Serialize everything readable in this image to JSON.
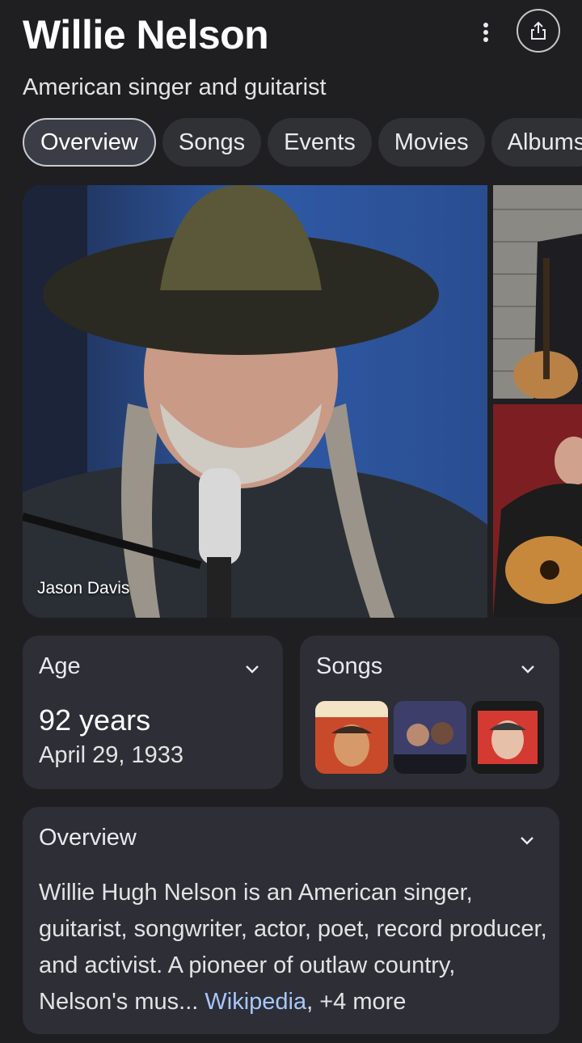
{
  "header": {
    "title": "Willie Nelson",
    "subtitle": "American singer and guitarist",
    "more_icon": "more-vert-icon",
    "share_icon": "share-icon"
  },
  "tabs": [
    {
      "label": "Overview",
      "active": true
    },
    {
      "label": "Songs",
      "active": false
    },
    {
      "label": "Events",
      "active": false
    },
    {
      "label": "Movies",
      "active": false
    },
    {
      "label": "Albums",
      "active": false
    }
  ],
  "images": {
    "main_credit": "Jason Davis"
  },
  "age_card": {
    "heading": "Age",
    "value": "92 years",
    "date": "April 29, 1933"
  },
  "songs_card": {
    "heading": "Songs"
  },
  "overview_card": {
    "heading": "Overview",
    "text": "Willie Hugh Nelson is an American singer, guitarist, songwriter, actor, poet, record producer, and activist. A pioneer of outlaw country, Nelson's mus...",
    "source_link": "Wikipedia",
    "more": ", +4 more"
  },
  "colors": {
    "background": "#1f1f21",
    "card": "#2d2e36",
    "link": "#a8c7fa"
  }
}
